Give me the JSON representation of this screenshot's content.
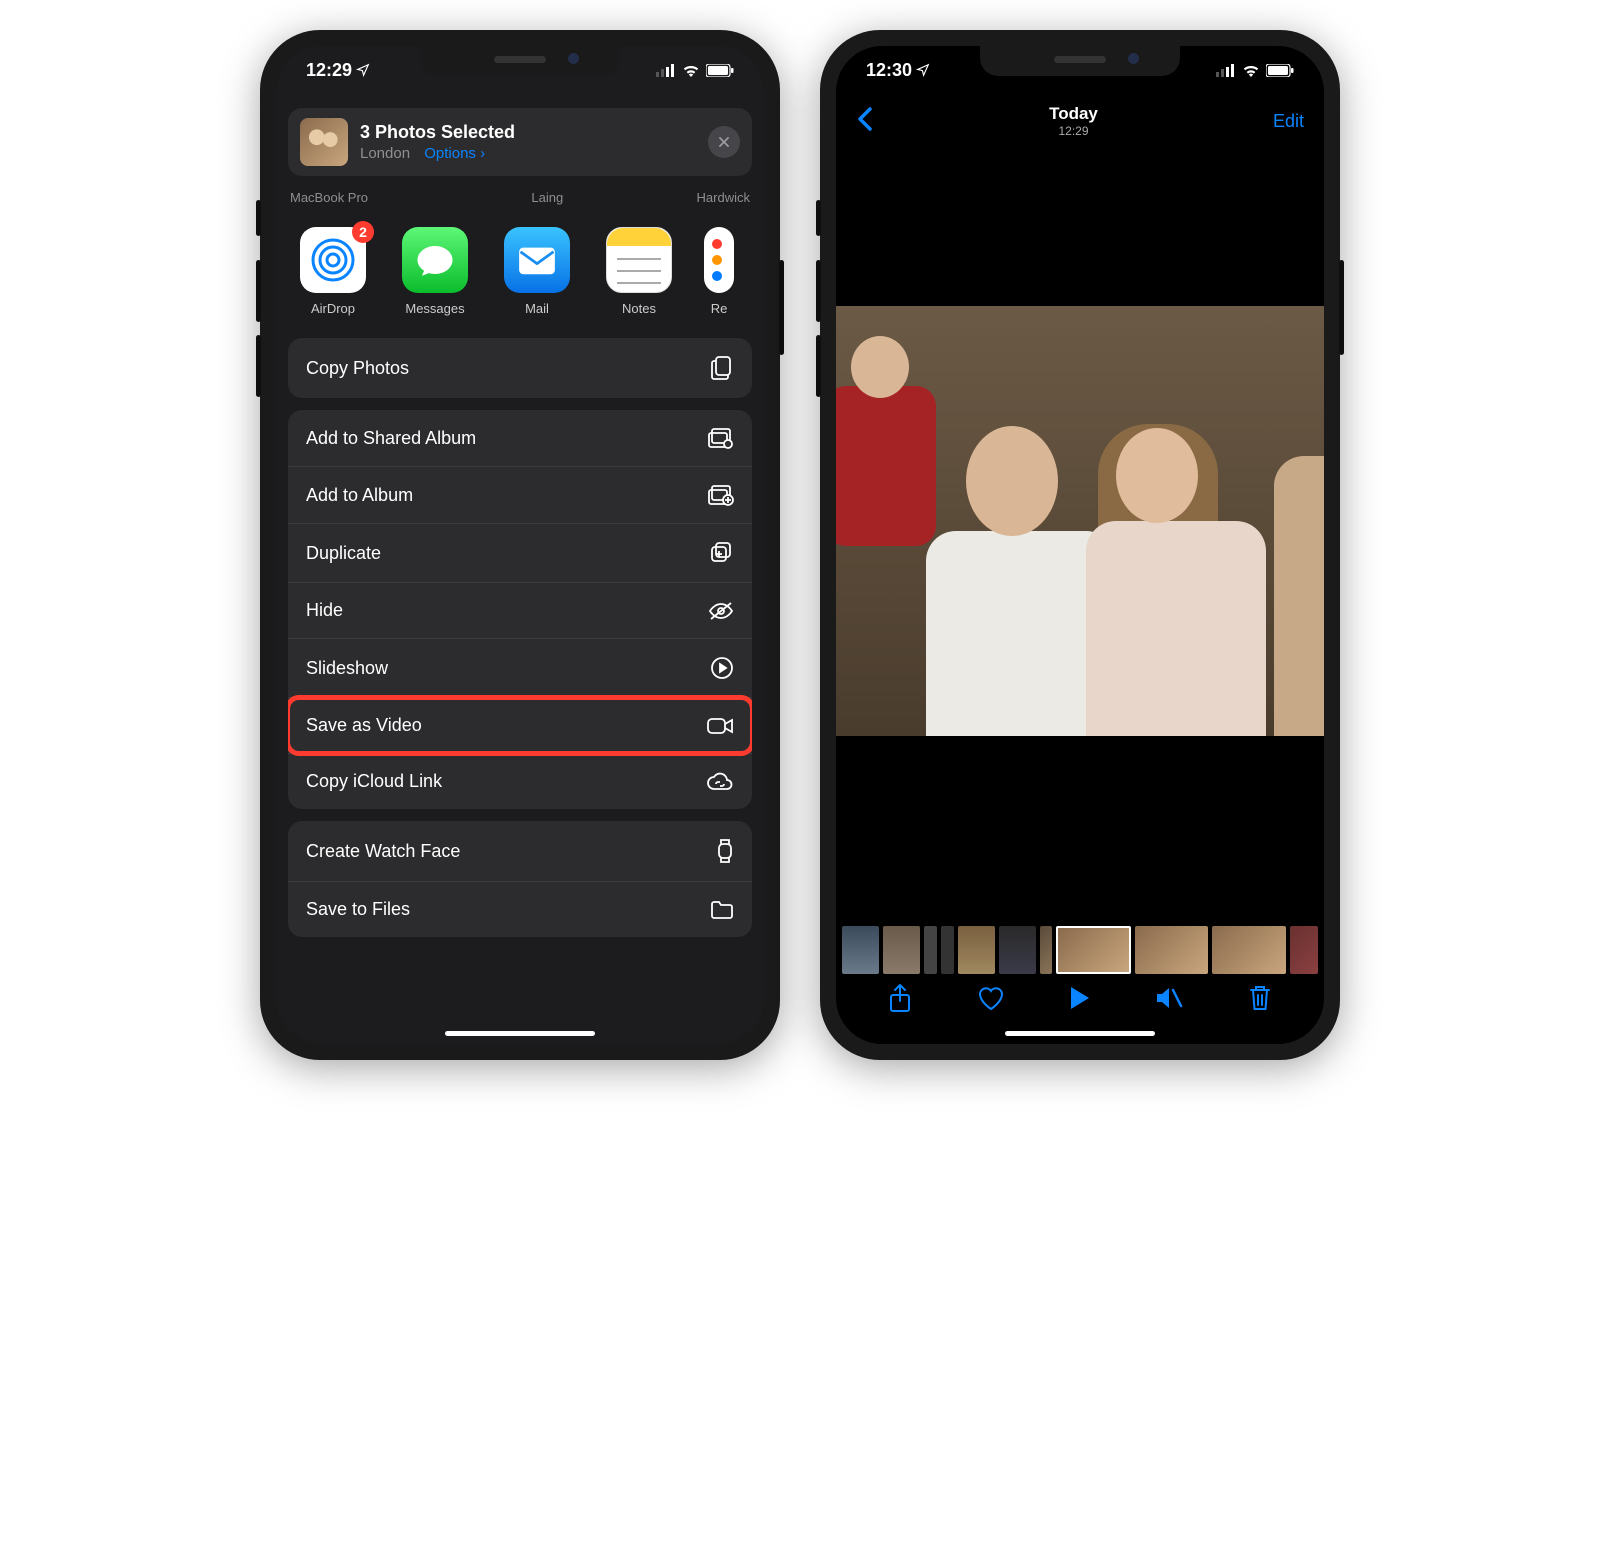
{
  "left": {
    "status_time": "12:29",
    "share": {
      "title": "3 Photos Selected",
      "location": "London",
      "options_label": "Options"
    },
    "airdrop_targets": [
      "MacBook Pro",
      "Laing",
      "Hardwick"
    ],
    "apps": [
      {
        "label": "AirDrop",
        "badge": "2"
      },
      {
        "label": "Messages",
        "badge": null
      },
      {
        "label": "Mail",
        "badge": null
      },
      {
        "label": "Notes",
        "badge": null
      },
      {
        "label": "Re",
        "badge": null
      }
    ],
    "actions": {
      "copy_photos": "Copy Photos",
      "add_shared_album": "Add to Shared Album",
      "add_album": "Add to Album",
      "duplicate": "Duplicate",
      "hide": "Hide",
      "slideshow": "Slideshow",
      "save_video": "Save as Video",
      "copy_icloud": "Copy iCloud Link",
      "create_watch": "Create Watch Face",
      "save_files": "Save to Files"
    }
  },
  "right": {
    "status_time": "12:30",
    "nav": {
      "title": "Today",
      "subtitle": "12:29",
      "edit": "Edit"
    }
  }
}
